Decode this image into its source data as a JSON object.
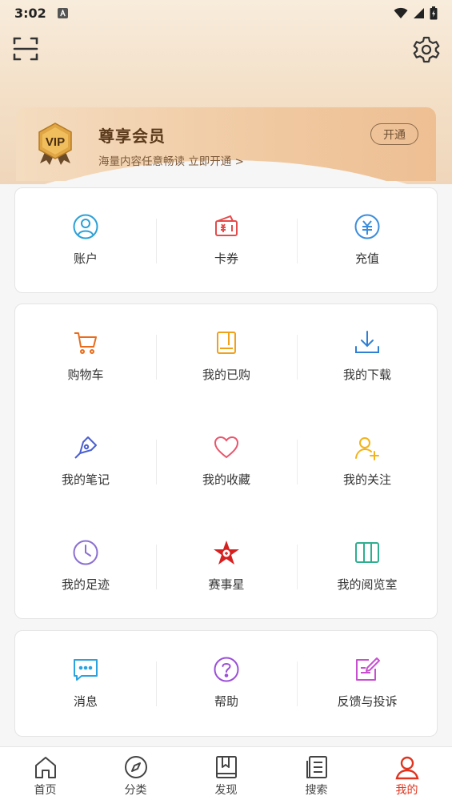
{
  "status_bar": {
    "time": "3:02"
  },
  "vip": {
    "badge_text": "VIP",
    "title": "尊享会员",
    "subtitle": "海量内容任意畅读 立即开通 >",
    "open_button": "开通"
  },
  "section_wallet": {
    "items": [
      {
        "label": "账户",
        "icon": "account-icon"
      },
      {
        "label": "卡券",
        "icon": "coupon-icon"
      },
      {
        "label": "充值",
        "icon": "recharge-icon"
      }
    ]
  },
  "section_content": {
    "items": [
      {
        "label": "购物车",
        "icon": "cart-icon"
      },
      {
        "label": "我的已购",
        "icon": "purchased-icon"
      },
      {
        "label": "我的下载",
        "icon": "download-icon"
      },
      {
        "label": "我的笔记",
        "icon": "pen-icon"
      },
      {
        "label": "我的收藏",
        "icon": "heart-icon"
      },
      {
        "label": "我的关注",
        "icon": "follow-icon"
      },
      {
        "label": "我的足迹",
        "icon": "clock-icon"
      },
      {
        "label": "赛事星",
        "icon": "star-icon"
      },
      {
        "label": "我的阅览室",
        "icon": "reading-room-icon"
      }
    ]
  },
  "section_support": {
    "items": [
      {
        "label": "消息",
        "icon": "message-icon"
      },
      {
        "label": "帮助",
        "icon": "help-icon"
      },
      {
        "label": "反馈与投诉",
        "icon": "feedback-icon"
      }
    ]
  },
  "tabbar": {
    "items": [
      {
        "label": "首页",
        "icon": "home-icon",
        "active": false
      },
      {
        "label": "分类",
        "icon": "compass-icon",
        "active": false
      },
      {
        "label": "发现",
        "icon": "discover-icon",
        "active": false
      },
      {
        "label": "搜索",
        "icon": "search-list-icon",
        "active": false
      },
      {
        "label": "我的",
        "icon": "profile-icon",
        "active": true
      }
    ]
  },
  "colors": {
    "accent": "#e0341f",
    "vip_text": "#5b3a1c",
    "hero_bg": "#f3dfc6"
  }
}
